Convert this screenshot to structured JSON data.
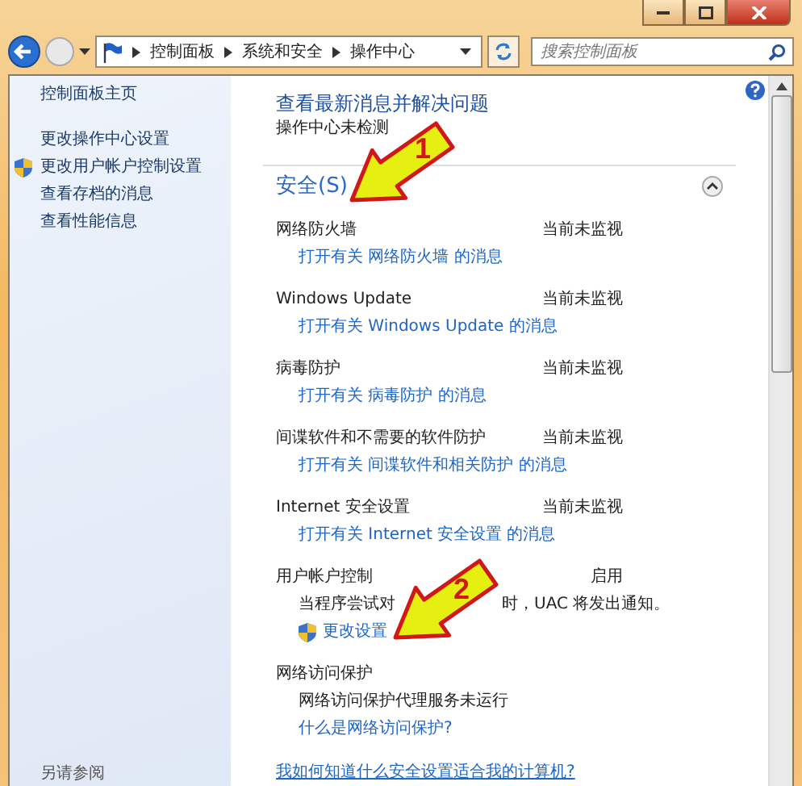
{
  "address_bar": {
    "breadcrumbs": [
      "控制面板",
      "系统和安全",
      "操作中心"
    ]
  },
  "search": {
    "placeholder": "搜索控制面板"
  },
  "sidebar": {
    "links": [
      {
        "label": "控制面板主页",
        "shield": false
      },
      {
        "label": "更改操作中心设置",
        "shield": false
      },
      {
        "label": "更改用户帐户控制设置",
        "shield": true
      },
      {
        "label": "查看存档的消息",
        "shield": false
      },
      {
        "label": "查看性能信息",
        "shield": false
      }
    ],
    "see_also": "另请参阅"
  },
  "main": {
    "heading": "查看最新消息并解决问题",
    "description": "操作中心未检测",
    "section": {
      "title": "安全(S)",
      "expanded": true,
      "items": [
        {
          "title": "网络防火墙",
          "status": "当前未监视",
          "lines": [
            {
              "kind": "link",
              "text": "打开有关 网络防火墙 的消息"
            }
          ]
        },
        {
          "title": "Windows Update",
          "status": "当前未监视",
          "lines": [
            {
              "kind": "link",
              "text": "打开有关 Windows Update 的消息"
            }
          ]
        },
        {
          "title": "病毒防护",
          "status": "当前未监视",
          "lines": [
            {
              "kind": "link",
              "text": "打开有关 病毒防护 的消息"
            }
          ]
        },
        {
          "title": "间谍软件和不需要的软件防护",
          "status": "当前未监视",
          "lines": [
            {
              "kind": "link",
              "text": "打开有关 间谍软件和相关防护 的消息"
            }
          ]
        },
        {
          "title": "Internet 安全设置",
          "status": "当前未监视",
          "lines": [
            {
              "kind": "link",
              "text": "打开有关 Internet 安全设置 的消息"
            }
          ]
        },
        {
          "title": "用户帐户控制",
          "status": "启用",
          "lines": [
            {
              "kind": "text",
              "text": "当程序尝试对",
              "text_after": "时，UAC 将发出通知。"
            },
            {
              "kind": "shield-link",
              "text": "更改设置"
            }
          ]
        },
        {
          "title": "网络访问保护",
          "lines": [
            {
              "kind": "text",
              "text": "网络访问保护代理服务未运行"
            },
            {
              "kind": "link",
              "text": "什么是网络访问保护?"
            }
          ]
        }
      ]
    },
    "footer_link": "我如何知道什么安全设置适合我的计算机?"
  },
  "annotations": [
    {
      "label": "1"
    },
    {
      "label": "2"
    }
  ]
}
